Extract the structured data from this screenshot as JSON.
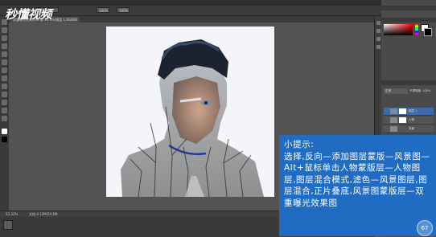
{
  "app": {
    "logo_text": "秒懂视频"
  },
  "options": {
    "fields": [
      "正常",
      "100%",
      "100%"
    ]
  },
  "document": {
    "tab_label": "双重曝光效果.psd @ 33.3%(图层 1,RGB/8)"
  },
  "status": {
    "zoom": "33.33%",
    "doc_info": "文档:4.12M/20.6M"
  },
  "layers_panel": {
    "blend_mode": "正常",
    "opacity_label": "不透明度: 100%",
    "layers": [
      {
        "name": "图层 1",
        "selected": true
      },
      {
        "name": "人物",
        "selected": false
      },
      {
        "name": "背景",
        "selected": false
      }
    ]
  },
  "tip": {
    "title": "小提示:",
    "body": "选择,反向—添加图层蒙版—风景图—Alt+鼠标单击人物蒙版层—人物图层,图层混合模式,滤色—风景图层,图层混合,正片叠底,风景图蒙版层—双重曝光效果图"
  },
  "badge": {
    "label": "67"
  },
  "colors": {
    "tip_bg": "#1e6ec8",
    "workspace": "#535353"
  }
}
